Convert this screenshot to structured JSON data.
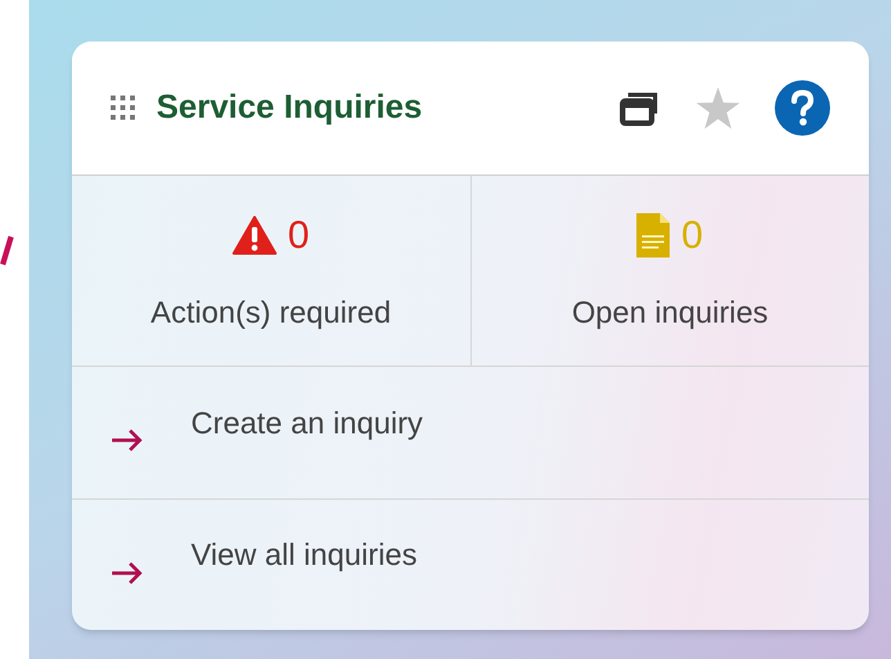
{
  "card": {
    "title": "Service Inquiries"
  },
  "stats": [
    {
      "kind": "warning",
      "count": "0",
      "label": "Action(s) required",
      "color": "#e0201a"
    },
    {
      "kind": "document",
      "count": "0",
      "label": "Open inquiries",
      "color": "#d8b000"
    }
  ],
  "links": [
    {
      "label": "Create an inquiry"
    },
    {
      "label": "View all inquiries"
    }
  ]
}
